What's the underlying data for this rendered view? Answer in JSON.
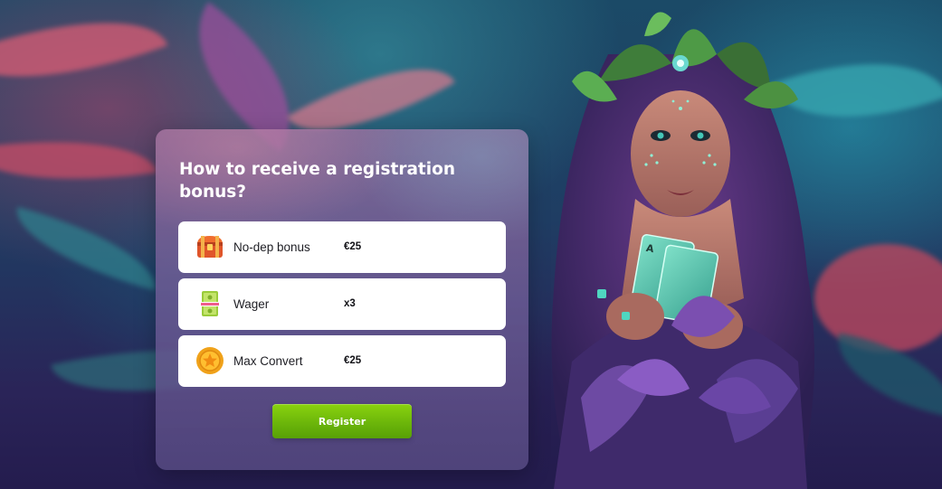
{
  "bonus_card": {
    "title": "How to receive a registration bonus?",
    "rows": [
      {
        "icon": "treasure-chest-icon",
        "label": "No-dep bonus",
        "value": "€25"
      },
      {
        "icon": "cash-stack-icon",
        "label": "Wager",
        "value": "x3"
      },
      {
        "icon": "gold-coin-icon",
        "label": "Max Convert",
        "value": "€25"
      }
    ],
    "register_label": "Register"
  },
  "colors": {
    "accent_green": "#7cc50c",
    "card_text": "#ffffff",
    "row_background": "#ffffff",
    "page_background": "#241c4e"
  }
}
